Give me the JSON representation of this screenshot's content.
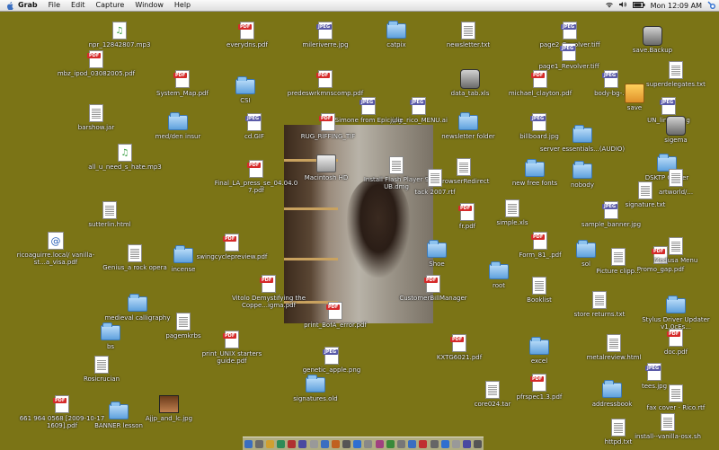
{
  "menubar": {
    "app": "Grab",
    "items": [
      "File",
      "Edit",
      "Capture",
      "Window",
      "Help"
    ],
    "clock": "Mon 12:09 AM"
  },
  "desktop_icons": [
    {
      "label": "npr_12842807.mp3",
      "kind": "music"
    },
    {
      "label": "everydns.pdf",
      "kind": "pdf"
    },
    {
      "label": "mileriverre.jpg",
      "kind": "jpg"
    },
    {
      "label": "catpix",
      "kind": "folder"
    },
    {
      "label": "newsletter.txt",
      "kind": "txt"
    },
    {
      "label": "page2_Revolver.tiff",
      "kind": "jpg"
    },
    {
      "label": "save.Backup",
      "kind": "app"
    },
    {
      "label": "mbz_ipod_03082005.pdf",
      "kind": "pdf"
    },
    {
      "label": "page1_Revolver.tiff",
      "kind": "jpg"
    },
    {
      "label": "superdelegates.txt",
      "kind": "txt"
    },
    {
      "label": "System_Map.pdf",
      "kind": "pdf"
    },
    {
      "label": "predeswrkmnscomp.pdf",
      "kind": "pdf"
    },
    {
      "label": "data_tab.xls",
      "kind": "app"
    },
    {
      "label": "michael_clayton.pdf",
      "kind": "pdf"
    },
    {
      "label": "body-bg-...",
      "kind": "jpg"
    },
    {
      "label": "save",
      "kind": "pkg"
    },
    {
      "label": "CSI",
      "kind": "folder"
    },
    {
      "label": "Simone from Epic.jpg",
      "kind": "jpg"
    },
    {
      "label": "julie_rico_MENU.ai",
      "kind": "jpg"
    },
    {
      "label": "UN_lines9.jpg",
      "kind": "jpg"
    },
    {
      "label": "barshow.jar",
      "kind": "doc"
    },
    {
      "label": "med/den insur",
      "kind": "folder"
    },
    {
      "label": "cd.GIF",
      "kind": "jpg"
    },
    {
      "label": "RUG_RIFFING_TIF",
      "kind": "pdf"
    },
    {
      "label": "newsletter folder",
      "kind": "folder"
    },
    {
      "label": "billboard.jpg",
      "kind": "jpg"
    },
    {
      "label": "sigema",
      "kind": "app"
    },
    {
      "label": "all_u_need_s_hate.mp3",
      "kind": "music"
    },
    {
      "label": "Macintosh HD",
      "kind": "hd"
    },
    {
      "label": "server essentials...(AUDIO)",
      "kind": "folder"
    },
    {
      "label": "Final_LA_press_se_04.04.07.pdf",
      "kind": "pdf"
    },
    {
      "label": "Install Flash Player 9 UB.dmg",
      "kind": "doc"
    },
    {
      "label": "browserRedirect",
      "kind": "doc"
    },
    {
      "label": "new free fonts",
      "kind": "folder"
    },
    {
      "label": "nobody",
      "kind": "folder"
    },
    {
      "label": "DSKTP Clutter",
      "kind": "folder"
    },
    {
      "label": "artworld/...",
      "kind": "txt"
    },
    {
      "label": "tack 2007.rtf",
      "kind": "txt"
    },
    {
      "label": "signature.txt",
      "kind": "txt"
    },
    {
      "label": "sutterlin.html",
      "kind": "doc"
    },
    {
      "label": "fr.pdf",
      "kind": "pdf"
    },
    {
      "label": "simple.xls",
      "kind": "doc"
    },
    {
      "label": "sample_banner.jpg",
      "kind": "jpg"
    },
    {
      "label": "ricoaguirre.local/ vanilla-st...a_visa.pdf",
      "kind": "webloc"
    },
    {
      "label": "Genius_a rock opera",
      "kind": "txt"
    },
    {
      "label": "incense",
      "kind": "folder"
    },
    {
      "label": "swingcyclepreview.pdf",
      "kind": "pdf"
    },
    {
      "label": "Shoe",
      "kind": "folder"
    },
    {
      "label": "Form_81_.pdf",
      "kind": "pdf"
    },
    {
      "label": "sol",
      "kind": "folder"
    },
    {
      "label": "Picture clipp...",
      "kind": "txt"
    },
    {
      "label": "Promo_gap.pdf",
      "kind": "pdf"
    },
    {
      "label": "Medusa Menu",
      "kind": "txt"
    },
    {
      "label": "Vitolo Demystifying the Coppe...igma.pdf",
      "kind": "pdf"
    },
    {
      "label": "CustomerBillManager",
      "kind": "pdf"
    },
    {
      "label": "root",
      "kind": "folder"
    },
    {
      "label": "Booklist",
      "kind": "doc"
    },
    {
      "label": "medieval calligraphy",
      "kind": "folder"
    },
    {
      "label": "pagemkrbs",
      "kind": "doc"
    },
    {
      "label": "print_BofA_error.pdf",
      "kind": "pdf"
    },
    {
      "label": "store returns.txt",
      "kind": "txt"
    },
    {
      "label": "Stylus Driver Updater v1.0cEs...",
      "kind": "folder"
    },
    {
      "label": "bs",
      "kind": "folder"
    },
    {
      "label": "print_UNIX starters guide.pdf",
      "kind": "pdf"
    },
    {
      "label": "KXTG6021.pdf",
      "kind": "pdf"
    },
    {
      "label": "excel",
      "kind": "folder"
    },
    {
      "label": "metalreview.html",
      "kind": "doc"
    },
    {
      "label": "doc.pdf",
      "kind": "pdf"
    },
    {
      "label": "Rosicrucian",
      "kind": "doc"
    },
    {
      "label": "genetic_apple.png",
      "kind": "jpg"
    },
    {
      "label": "tees.jpg",
      "kind": "jpg"
    },
    {
      "label": "signatures.old",
      "kind": "folder"
    },
    {
      "label": "pfrspec1.3.pdf",
      "kind": "pdf"
    },
    {
      "label": "addressbook",
      "kind": "folder"
    },
    {
      "label": "661 964 0568 [2009-10-17 1609].pdf",
      "kind": "pdf"
    },
    {
      "label": "BANNER lesson",
      "kind": "folder"
    },
    {
      "label": "Ajjp_and_lc.jpg",
      "kind": "thumb"
    },
    {
      "label": "core024.tar",
      "kind": "doc"
    },
    {
      "label": "fax cover - Rico.rtf",
      "kind": "txt"
    },
    {
      "label": "httpd.txt",
      "kind": "txt"
    },
    {
      "label": "install--vanilla-osx.sh",
      "kind": "txt"
    }
  ],
  "colors": {
    "desktop": "#7b7416",
    "pdf_band": "#d52a2a",
    "folder": "#5fa1de"
  }
}
